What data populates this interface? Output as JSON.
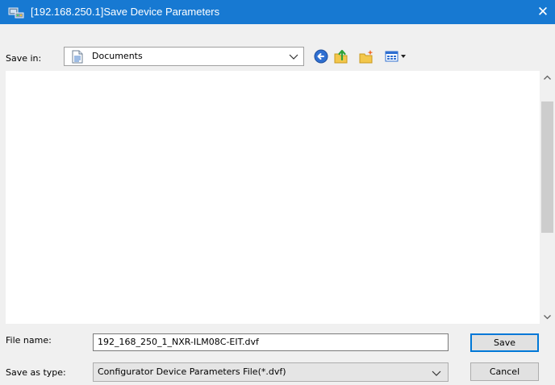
{
  "window": {
    "title": "[192.168.250.1]Save Device Parameters",
    "icon": "network-device-icon",
    "close_glyph": "✕"
  },
  "save_in": {
    "label": "Save in:",
    "value": "Documents",
    "icon": "documents-folder-icon"
  },
  "toolbar": {
    "buttons": [
      "back-icon",
      "up-folder-icon",
      "new-folder-icon",
      "view-menu-icon"
    ]
  },
  "file_list": {
    "items": []
  },
  "file_name": {
    "label": "File name:",
    "value": "192_168_250_1_NXR-ILM08C-EIT.dvf"
  },
  "save_as_type": {
    "label": "Save as type:",
    "value": "Configurator Device Parameters File(*.dvf)"
  },
  "buttons": {
    "save": "Save",
    "cancel": "Cancel"
  },
  "colors": {
    "titlebar": "#1779d2",
    "dialog_bg": "#f0f0f0",
    "default_button_border": "#0078d7"
  }
}
